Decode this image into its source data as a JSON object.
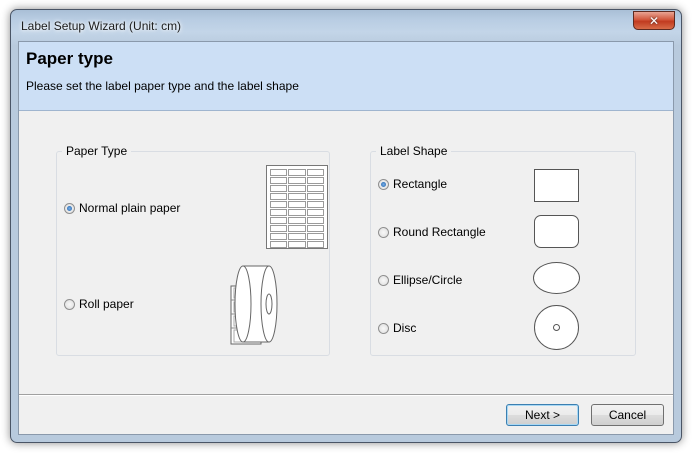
{
  "window": {
    "title": "Label Setup Wizard (Unit: cm)",
    "close_label": "✕"
  },
  "header": {
    "title": "Paper type",
    "subtitle": "Please set the label paper type and the label shape"
  },
  "paper_type": {
    "label": "Paper Type",
    "options": [
      {
        "label": "Normal plain paper",
        "checked": true,
        "icon": "label-sheet-icon"
      },
      {
        "label": "Roll paper",
        "checked": false,
        "icon": "label-roll-icon"
      }
    ]
  },
  "label_shape": {
    "label": "Label Shape",
    "options": [
      {
        "label": "Rectangle",
        "checked": true,
        "icon": "rectangle-shape-icon"
      },
      {
        "label": "Round Rectangle",
        "checked": false,
        "icon": "round-rectangle-shape-icon"
      },
      {
        "label": "Ellipse/Circle",
        "checked": false,
        "icon": "ellipse-shape-icon"
      },
      {
        "label": "Disc",
        "checked": false,
        "icon": "disc-shape-icon"
      }
    ]
  },
  "buttons": {
    "next": "Next >",
    "cancel": "Cancel"
  }
}
